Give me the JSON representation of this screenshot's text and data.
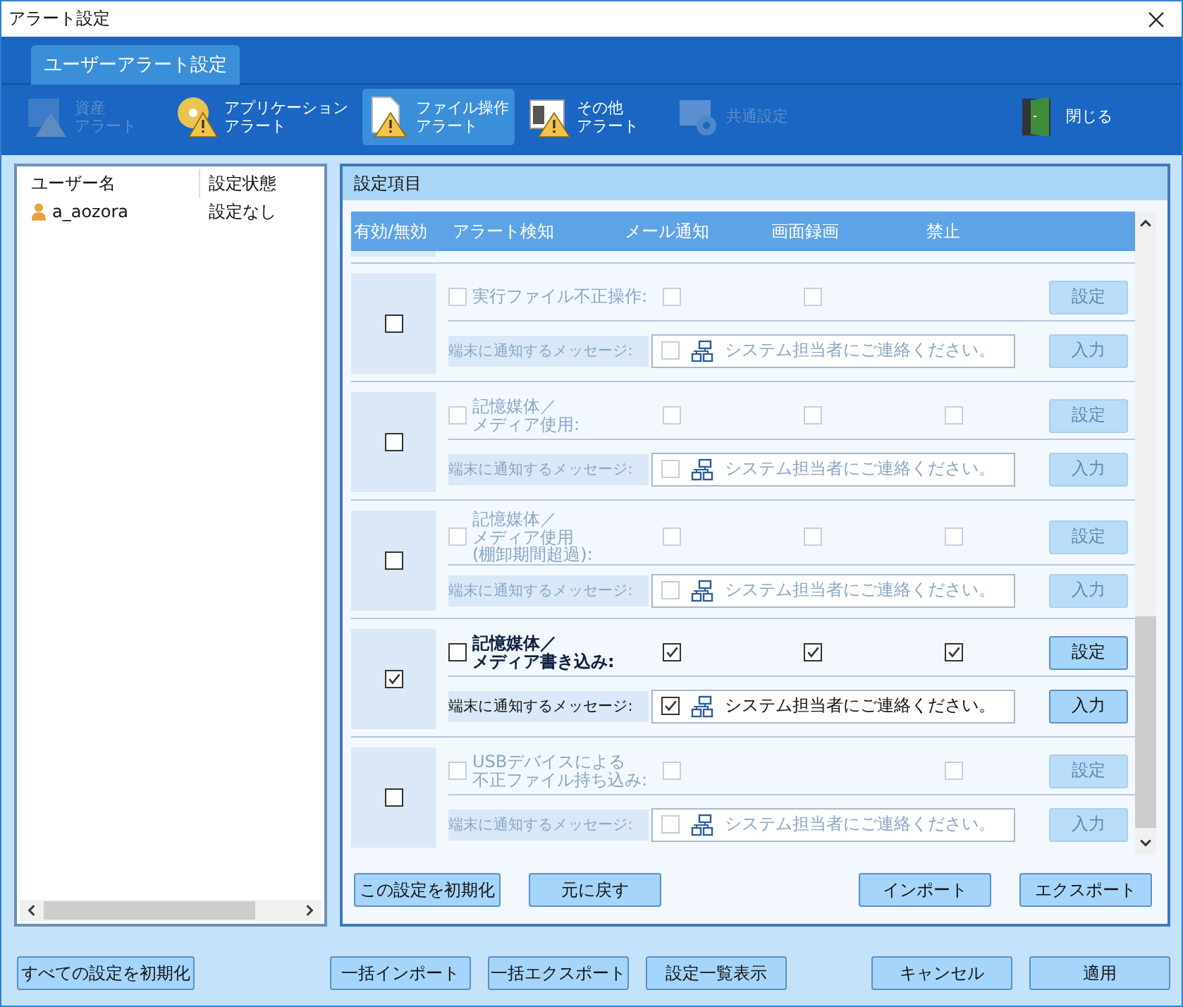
{
  "window": {
    "title": "アラート設定"
  },
  "tabs": [
    {
      "label": "ユーザーアラート設定",
      "selected": true
    }
  ],
  "toolbar": [
    {
      "kind": "asset",
      "label": [
        "資産",
        "アラート"
      ],
      "disabled": true,
      "selected": false
    },
    {
      "kind": "app",
      "label": [
        "アプリケーション",
        "アラート"
      ],
      "disabled": false,
      "selected": false
    },
    {
      "kind": "file",
      "label": [
        "ファイル操作",
        "アラート"
      ],
      "disabled": false,
      "selected": true
    },
    {
      "kind": "other",
      "label": [
        "その他",
        "アラート"
      ],
      "disabled": false,
      "selected": false
    },
    {
      "kind": "common",
      "label": [
        "共通設定"
      ],
      "disabled": true,
      "selected": false
    },
    {
      "kind": "close",
      "label": [
        "閉じる"
      ],
      "disabled": false,
      "selected": false
    }
  ],
  "users": {
    "columns": [
      "ユーザー名",
      "設定状態"
    ],
    "rows": [
      {
        "name": "a_aozora",
        "status": "設定なし"
      }
    ]
  },
  "panel": {
    "title": "設定項目",
    "columns": [
      "有効/無効",
      "アラート検知",
      "メール通知",
      "画面録画",
      "禁止"
    ],
    "rows": [
      {
        "label": [
          "実行ファイル不正操作:"
        ],
        "enabled": false,
        "detect": false,
        "mail": false,
        "record": false,
        "settings_button": "設定",
        "message_label": "端末に通知するメッセージ:",
        "message_checked": false,
        "message": "システム担当者にご連絡ください。",
        "input_button": "入力"
      },
      {
        "label": [
          "記憶媒体／",
          "メディア使用:"
        ],
        "enabled": false,
        "detect": false,
        "mail": false,
        "record": false,
        "prohibit": false,
        "settings_button": "設定",
        "message_label": "端末に通知するメッセージ:",
        "message_checked": false,
        "message": "システム担当者にご連絡ください。",
        "input_button": "入力"
      },
      {
        "label": [
          "記憶媒体／",
          "メディア使用",
          "(棚卸期間超過):"
        ],
        "enabled": false,
        "detect": false,
        "mail": false,
        "record": false,
        "prohibit": false,
        "settings_button": "設定",
        "message_label": "端末に通知するメッセージ:",
        "message_checked": false,
        "message": "システム担当者にご連絡ください。",
        "input_button": "入力"
      },
      {
        "label": [
          "記憶媒体／",
          "メディア書き込み:"
        ],
        "enabled": true,
        "detect": false,
        "mail": true,
        "record": true,
        "prohibit": true,
        "settings_button": "設定",
        "message_label": "端末に通知するメッセージ:",
        "message_checked": true,
        "message": "システム担当者にご連絡ください。",
        "input_button": "入力"
      },
      {
        "label": [
          "USBデバイスによる",
          "不正ファイル持ち込み:"
        ],
        "enabled": false,
        "detect": false,
        "mail": false,
        "prohibit": false,
        "settings_button": "設定",
        "message_label": "端末に通知するメッセージ:",
        "message_checked": false,
        "message": "システム担当者にご連絡ください。",
        "input_button": "入力"
      }
    ],
    "buttons_left": [
      "この設定を初期化",
      "元に戻す"
    ],
    "buttons_right": [
      "インポート",
      "エクスポート"
    ]
  },
  "footer": {
    "left": [
      "すべての設定を初期化"
    ],
    "center": [
      "一括インポート",
      "一括エクスポート",
      "設定一覧表示"
    ],
    "right": [
      "キャンセル",
      "適用"
    ]
  }
}
